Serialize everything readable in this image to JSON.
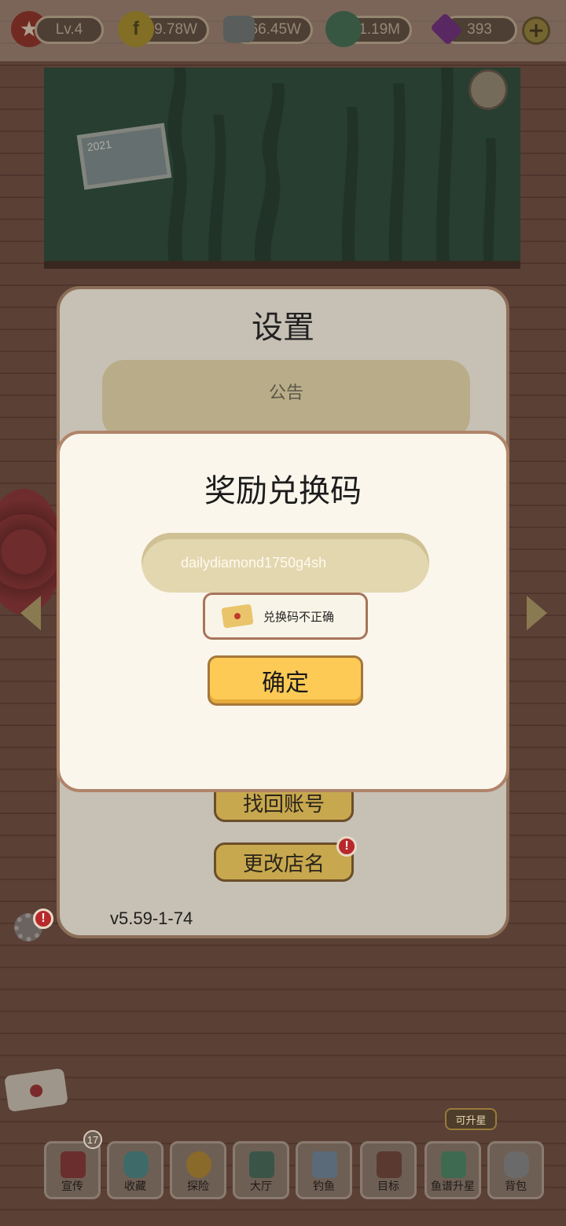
{
  "hud": {
    "level": "Lv.4",
    "coins": "29.78W",
    "cash": "66.45W",
    "clams": "1.19M",
    "diamonds": "393",
    "coin_icon_glyph": "f",
    "colors": {
      "coin": "#a08a2a",
      "diamond": "#6a2a7a",
      "clam": "#3e6a52",
      "cash": "#6a7272",
      "star": "#8a2e24"
    }
  },
  "scene": {
    "photo_year": "2021"
  },
  "settings": {
    "title": "设置",
    "notice_title": "公告",
    "recover_account_label": "找回账号",
    "rename_shop_label": "更改店名",
    "version": "v5.59-1-74"
  },
  "dialog": {
    "title": "奖励兑换码",
    "code_value": "dailydiamond1750g4sh",
    "toast_message": "兑换码不正确",
    "confirm_label": "确定"
  },
  "alerts": {
    "glyph": "!"
  },
  "bottom_nav": {
    "promote_badge": "17",
    "upgrade_tag": "可升星",
    "items": [
      {
        "label": "宣传",
        "icon": "flyer-icon"
      },
      {
        "label": "收藏",
        "icon": "bottle-icon"
      },
      {
        "label": "探险",
        "icon": "submarine-icon"
      },
      {
        "label": "大厅",
        "icon": "hall-icon"
      },
      {
        "label": "钓鱼",
        "icon": "fishing-icon"
      },
      {
        "label": "目标",
        "icon": "target-icon"
      },
      {
        "label": "鱼谱升星",
        "icon": "fish-book-icon"
      },
      {
        "label": "背包",
        "icon": "backpack-icon"
      }
    ]
  }
}
